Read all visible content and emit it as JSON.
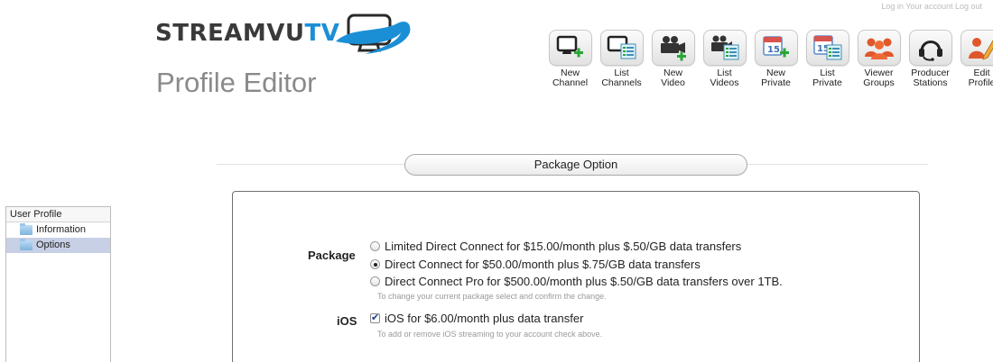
{
  "brand": {
    "logo_main": "STREAMVU",
    "logo_accent": "TV"
  },
  "page_title": "Profile Editor",
  "top_link": "Log in   Your account  Log out",
  "toolbar": [
    {
      "label": "New\nChannel",
      "icon": "new-channel-icon"
    },
    {
      "label": "List\nChannels",
      "icon": "list-channels-icon"
    },
    {
      "label": "New\nVideo",
      "icon": "new-video-icon"
    },
    {
      "label": "List\nVideos",
      "icon": "list-videos-icon"
    },
    {
      "label": "New\nPrivate",
      "icon": "new-private-icon"
    },
    {
      "label": "List\nPrivate",
      "icon": "list-private-icon"
    },
    {
      "label": "Viewer\nGroups",
      "icon": "viewer-groups-icon"
    },
    {
      "label": "Producer\nStations",
      "icon": "producer-stations-icon"
    },
    {
      "label": "Edit\nProfile",
      "icon": "edit-profile-icon"
    }
  ],
  "section_title": "Package Option",
  "sidebar": {
    "heading": "User Profile",
    "items": [
      {
        "label": "Information",
        "active": false
      },
      {
        "label": "Options",
        "active": true
      }
    ]
  },
  "form": {
    "package_label": "Package",
    "package_options": [
      {
        "label": "Limited Direct Connect for $15.00/month plus $.50/GB data transfers",
        "selected": false
      },
      {
        "label": "Direct Connect for $50.00/month plus $.75/GB data transfers",
        "selected": true
      },
      {
        "label": "Direct Connect Pro for $500.00/month plus $.50/GB data transfers over 1TB.",
        "selected": false
      }
    ],
    "package_hint": "To change your current package select and confirm the change.",
    "ios_label": "iOS",
    "ios_option": {
      "label": "iOS for $6.00/month plus data transfer",
      "checked": true
    },
    "ios_hint": "To add or remove iOS streaming to your account check above."
  },
  "colors": {
    "accent": "#1b8fd6",
    "sidebar_active": "#c7d0e5",
    "title_gray": "#8a8a8a"
  }
}
